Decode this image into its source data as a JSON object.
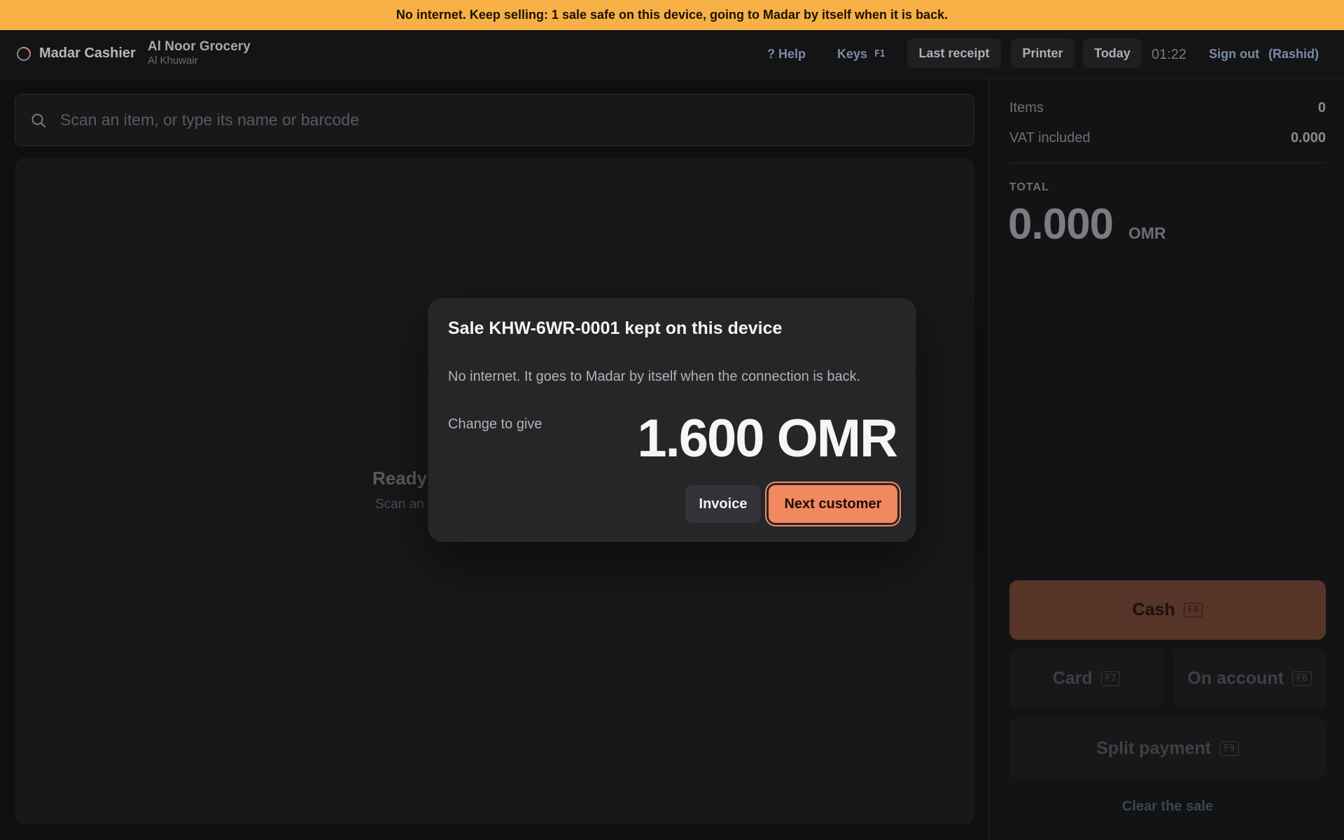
{
  "banner": {
    "text": "No internet. Keep selling: 1 sale safe on this device, going to Madar by itself when it is back."
  },
  "header": {
    "app_name": "Madar Cashier",
    "store_name": "Al Noor Grocery",
    "branch": "Al Khuwair",
    "help_label": "? Help",
    "keys_label": "Keys",
    "keys_shortcut": "F1",
    "last_receipt_label": "Last receipt",
    "printer_label": "Printer",
    "today_label": "Today",
    "clock": "01:22",
    "signout_label": "Sign out",
    "user": "(Rashid)"
  },
  "search": {
    "placeholder": "Scan an item, or type its name or barcode",
    "value": ""
  },
  "cart": {
    "empty_title": "Ready",
    "empty_sub": "Scan an"
  },
  "summary": {
    "items_label": "Items",
    "items_value": "0",
    "vat_label": "VAT included",
    "vat_value": "0.000",
    "total_label": "TOTAL",
    "total_value": "0.000",
    "currency": "OMR"
  },
  "payment": {
    "cash_label": "Cash",
    "cash_key": "F4",
    "card_label": "Card",
    "card_key": "F7",
    "account_label": "On account",
    "account_key": "F8",
    "split_label": "Split payment",
    "split_key": "F9",
    "clear_label": "Clear the sale"
  },
  "dialog": {
    "title": "Sale KHW-6WR-0001 kept on this device",
    "message": "No internet. It goes to Madar by itself when the connection is back.",
    "change_label": "Change to give",
    "change_amount": "1.600 OMR",
    "invoice_label": "Invoice",
    "next_label": "Next customer"
  },
  "colors": {
    "banner": "#f7b045",
    "accent": "#f1885f",
    "background": "#0f0f11"
  }
}
